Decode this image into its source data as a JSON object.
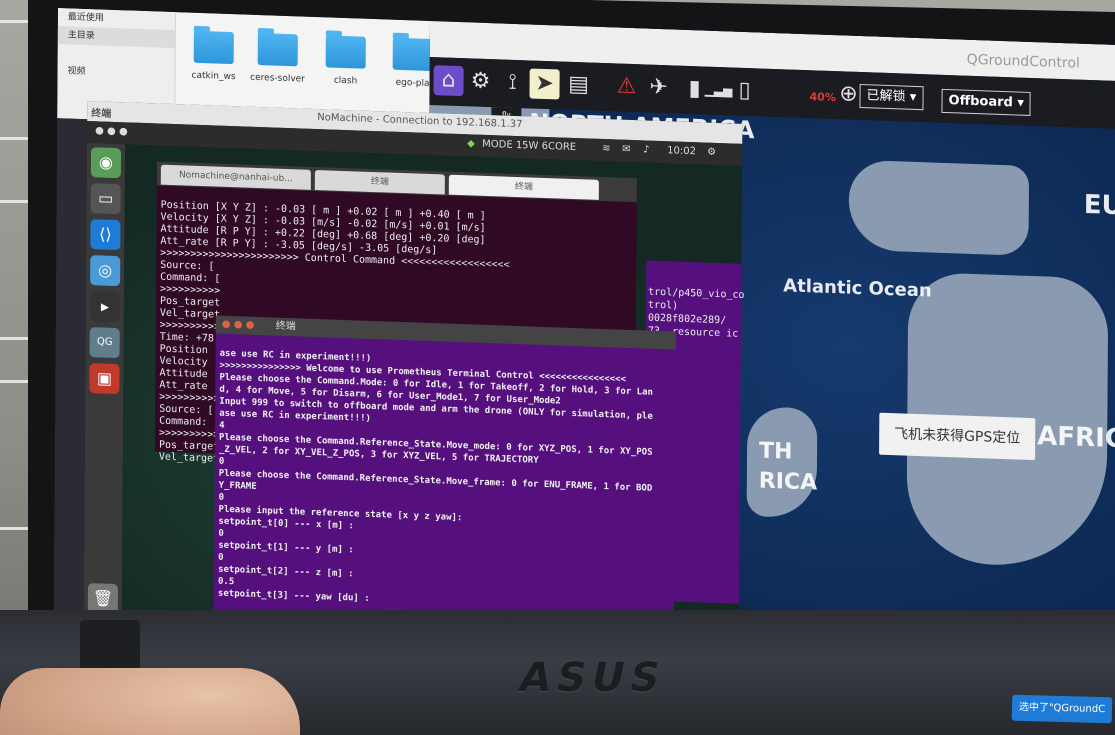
{
  "file_manager": {
    "sidebar": [
      "最近使用",
      "主目录",
      "",
      "视频",
      ""
    ],
    "folders": [
      "catkin_ws",
      "ceres-solver",
      "clash",
      "ego-pla"
    ]
  },
  "qgc": {
    "title": "QGroundControl",
    "battery_percent": "40%",
    "lock_status": "已解锁",
    "flight_mode": "Offboard",
    "fly_label": "fly",
    "toast": "飞机未获得GPS定位",
    "map_labels": [
      "NORTH AMERICA",
      "Atlantic Ocean",
      "EURO",
      "AFRICA",
      "TH",
      "RICA"
    ]
  },
  "nomachine": {
    "title": "NoMachine - Connection to 192.168.1.37",
    "terminal_label": "终端",
    "ubuntu_topbar": {
      "power_mode": "MODE 15W 6CORE",
      "time": "10:02"
    }
  },
  "terminal_bg": {
    "title": "终端",
    "tabs": [
      "Nomachine@nanhai-ub...",
      "终端",
      "终端"
    ],
    "lines": [
      "Position [X Y Z] : -0.03 [ m ] +0.02 [ m ] +0.40 [ m ]",
      "Velocity [X Y Z] : -0.03 [m/s] -0.02 [m/s] +0.01 [m/s]",
      "Attitude [R P Y] : +0.22 [deg] +0.68 [deg] +0.20 [deg]",
      "Att_rate [R P Y] : -3.05 [deg/s] -3.05 [deg/s]",
      ">>>>>>>>>>>>>>>>>>>>>>> Control Command <<<<<<<<<<<<<<<<<<",
      "Source: [",
      "Command: [",
      ">>>>>>>>>>",
      "Pos_target",
      "Vel_target",
      ">>>>>>>>>>",
      "Time: +78.",
      "Position [",
      "Velocity [",
      "Attitude [",
      "Att_rate [",
      ">>>>>>>>>>",
      "Source: [",
      "Command: [",
      ">>>>>>>>>>",
      "Pos_target",
      "Vel_target"
    ]
  },
  "terminal_fg": {
    "title": "终端",
    "lines": [
      "ase use RC in experiment!!!)",
      ">>>>>>>>>>>>>>> Welcome to use Prometheus Terminal Control <<<<<<<<<<<<<<<<",
      "Please choose the Command.Mode: 0 for Idle, 1 for Takeoff, 2 for Hold, 3 for Lan",
      "d, 4 for Move, 5 for Disarm, 6 for User_Mode1, 7 for User_Mode2",
      "Input 999 to switch to offboard mode and arm the drone (ONLY for simulation, ple",
      "ase use RC in experiment!!!)",
      "4",
      "Please choose the Command.Reference_State.Move_mode: 0 for XYZ_POS, 1 for XY_POS",
      "_Z_VEL, 2 for XY_VEL_Z_POS, 3 for XYZ_VEL, 5 for TRAJECTORY",
      "0",
      "Please choose the Command.Reference_State.Move_frame: 0 for ENU_FRAME, 1 for BOD",
      "Y_FRAME",
      "0",
      "Please input the reference state [x y z yaw]:",
      "setpoint_t[0] --- x [m] :",
      "0",
      "setpoint_t[1] --- y [m] :",
      "0",
      "setpoint_t[2] --- z [m] :",
      "0.5",
      "setpoint_t[3] --- yaw [du] :"
    ]
  },
  "terminal_right": {
    "lines": [
      "trol/p450_vio_co",
      "",
      "",
      "",
      "",
      "",
      "",
      "",
      "",
      "",
      "",
      "",
      "",
      "",
      "",
      "",
      "",
      "trol)",
      "",
      "",
      "",
      "",
      "",
      "",
      "",
      "0028f802e289/",
      "73, resource ic"
    ]
  },
  "corner_button": "选中了\"QGroundC"
}
